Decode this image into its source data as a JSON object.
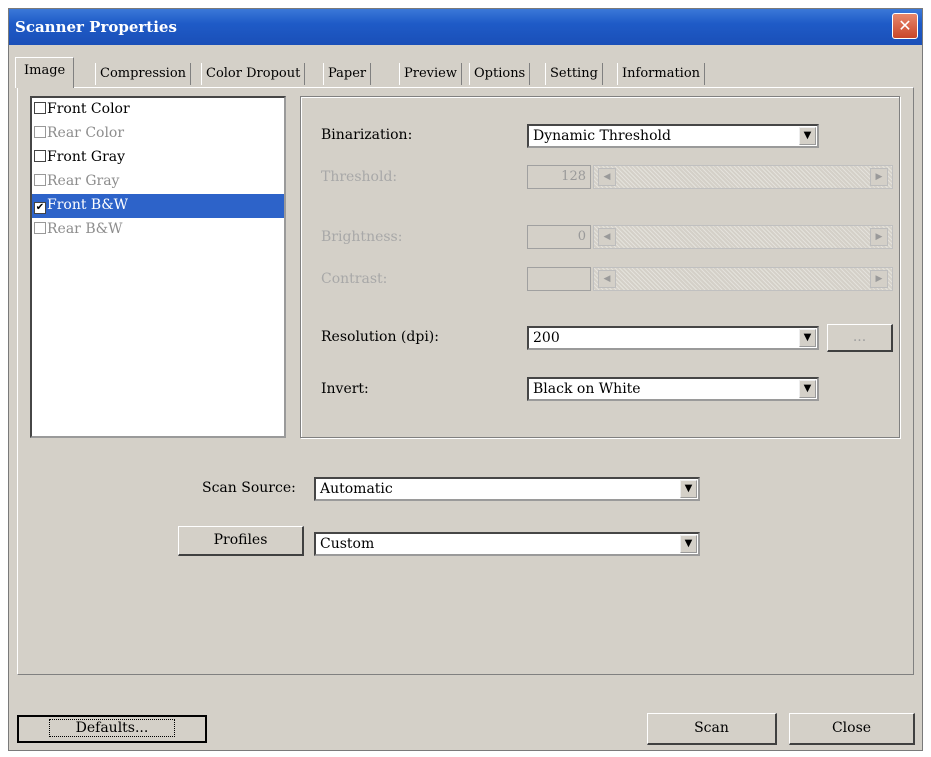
{
  "window": {
    "title": "Scanner Properties",
    "close_glyph": "✕"
  },
  "tabs": [
    {
      "label": "Image",
      "active": true
    },
    {
      "label": "Compression"
    },
    {
      "label": "Color Dropout"
    },
    {
      "label": "Paper"
    },
    {
      "label": "Preview"
    },
    {
      "label": "Options"
    },
    {
      "label": "Setting"
    },
    {
      "label": "Information"
    }
  ],
  "image_list": [
    {
      "label": "Front Color",
      "checked": false,
      "enabled": true
    },
    {
      "label": "Rear Color",
      "checked": false,
      "enabled": false
    },
    {
      "label": "Front Gray",
      "checked": false,
      "enabled": true
    },
    {
      "label": "Rear Gray",
      "checked": false,
      "enabled": false
    },
    {
      "label": "Front B&W",
      "checked": true,
      "enabled": true,
      "selected": true
    },
    {
      "label": "Rear B&W",
      "checked": false,
      "enabled": false
    }
  ],
  "settings": {
    "binarization_label": "Binarization:",
    "binarization_value": "Dynamic Threshold",
    "threshold_label": "Threshold:",
    "threshold_value": "128",
    "brightness_label": "Brightness:",
    "brightness_value": "0",
    "contrast_label": "Contrast:",
    "contrast_value": "",
    "resolution_label": "Resolution (dpi):",
    "resolution_value": "200",
    "resolution_more": "...",
    "invert_label": "Invert:",
    "invert_value": "Black on White"
  },
  "scan_source": {
    "label": "Scan Source:",
    "value": "Automatic"
  },
  "profiles": {
    "button_label": "Profiles",
    "value": "Custom"
  },
  "footer": {
    "defaults_label": "Defaults...",
    "scan_label": "Scan",
    "close_label": "Close"
  },
  "icons": {
    "dropdown": "▼",
    "left_arrow": "◀",
    "right_arrow": "▶",
    "check": "✔"
  }
}
